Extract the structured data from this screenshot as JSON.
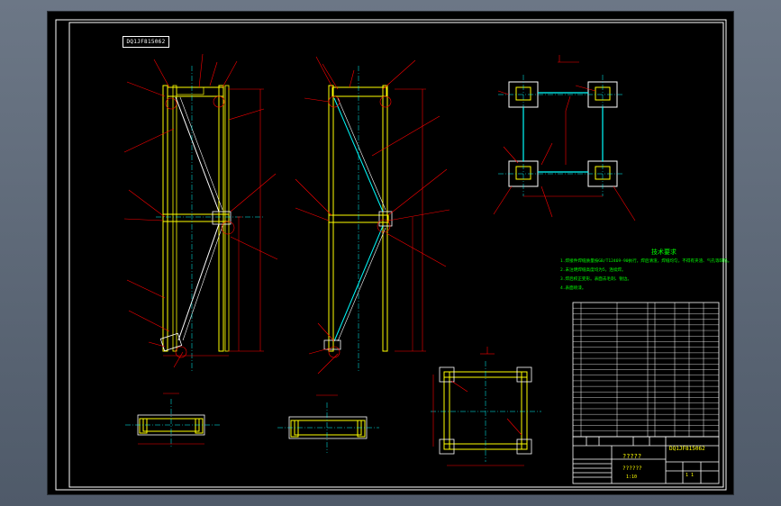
{
  "drawing": {
    "stamp_text": "DQ1JF815062",
    "tech_notes_title": "技术要求",
    "tech_notes": [
      "1.焊接件焊缝质量按GB/T12469-90执行，焊后清渣，焊缝均匀，不得有夹渣、气孔等缺陷。",
      "2.未注明焊缝高度均为5，连续焊。",
      "3.焊后校正变形。表面去毛刺、锐边。",
      "4.表面喷漆。"
    ],
    "title_block": {
      "title": "?????",
      "subtitle": "??????",
      "scale_text": "1:10",
      "drawing_number": "DQ1JF815062",
      "sheet_text": "1  1"
    }
  },
  "colors": {
    "background": "#000000",
    "frame": "#ffffff",
    "steel": "#ffff00",
    "leader": "#ff0000",
    "dimension": "#ff0000",
    "centerline": "#00ffff",
    "notes": "#00ff00"
  }
}
